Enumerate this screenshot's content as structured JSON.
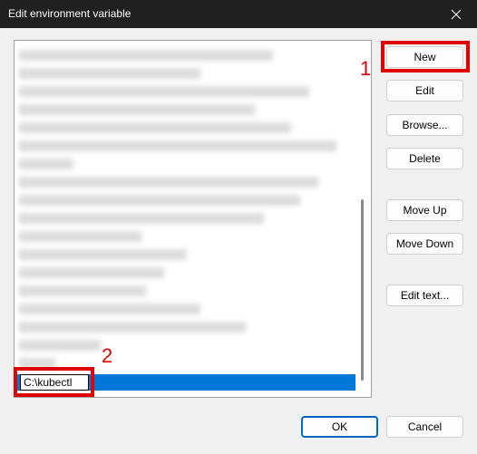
{
  "window": {
    "title": "Edit environment variable"
  },
  "list": {
    "edit_value": "C:\\kubectl"
  },
  "buttons": {
    "new": "New",
    "edit": "Edit",
    "browse": "Browse...",
    "delete": "Delete",
    "move_up": "Move Up",
    "move_down": "Move Down",
    "edit_text": "Edit text...",
    "ok": "OK",
    "cancel": "Cancel"
  },
  "annotations": {
    "marker_1": "1",
    "marker_2": "2"
  },
  "colors": {
    "titlebar": "#202020",
    "selection": "#0078d7",
    "highlight": "#e00000",
    "primary_border": "#0067c0"
  }
}
